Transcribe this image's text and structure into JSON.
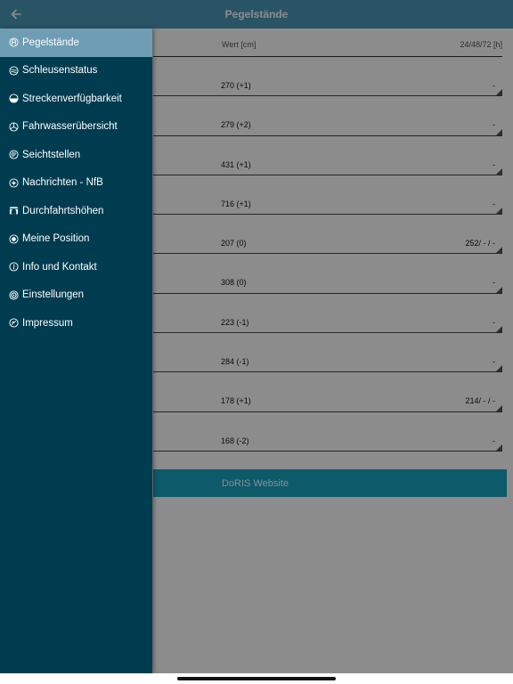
{
  "header": {
    "title": "Pegelstände",
    "back_icon": "arrow-left-icon"
  },
  "table": {
    "col_value": "Wert [cm]",
    "col_hours": "24/48/72 [h]",
    "rows": [
      {
        "value": "270 (+1)",
        "forecast": "-"
      },
      {
        "value": "279 (+2)",
        "forecast": "-"
      },
      {
        "value": "431 (+1)",
        "forecast": "-"
      },
      {
        "value": "716 (+1)",
        "forecast": "-"
      },
      {
        "value": "207 (0)",
        "forecast": "252/ - / -"
      },
      {
        "value": "308 (0)",
        "forecast": "-"
      },
      {
        "value": "223 (-1)",
        "forecast": "-"
      },
      {
        "value": "284 (-1)",
        "forecast": "-"
      },
      {
        "value": "178 (+1)",
        "forecast": "214/ - / -"
      },
      {
        "value": "168 (-2)",
        "forecast": "-"
      }
    ]
  },
  "website_button": "DoRIS Website",
  "menu": {
    "items": [
      {
        "label": "Pegelstände",
        "icon": "gauge-icon",
        "active": true
      },
      {
        "label": "Schleusenstatus",
        "icon": "lock-waves-icon",
        "active": false
      },
      {
        "label": "Streckenverfügbarkeit",
        "icon": "half-circle-icon",
        "active": false
      },
      {
        "label": "Fahrwasserübersicht",
        "icon": "helm-icon",
        "active": false
      },
      {
        "label": "Seichtstellen",
        "icon": "shallow-icon",
        "active": false
      },
      {
        "label": "Nachrichten - NfB",
        "icon": "news-icon",
        "active": false
      },
      {
        "label": "Durchfahrtshöhen",
        "icon": "bridge-icon",
        "active": false
      },
      {
        "label": "Meine Position",
        "icon": "position-icon",
        "active": false
      },
      {
        "label": "Info und Kontakt",
        "icon": "info-icon",
        "active": false
      },
      {
        "label": "Einstellungen",
        "icon": "settings-icon",
        "active": false
      },
      {
        "label": "Impressum",
        "icon": "imprint-icon",
        "active": false
      }
    ]
  },
  "colors": {
    "header": "#4b9ab8",
    "menu_bg": "#003c4f",
    "menu_active": "#6e9db4",
    "button": "#18a5c4"
  }
}
